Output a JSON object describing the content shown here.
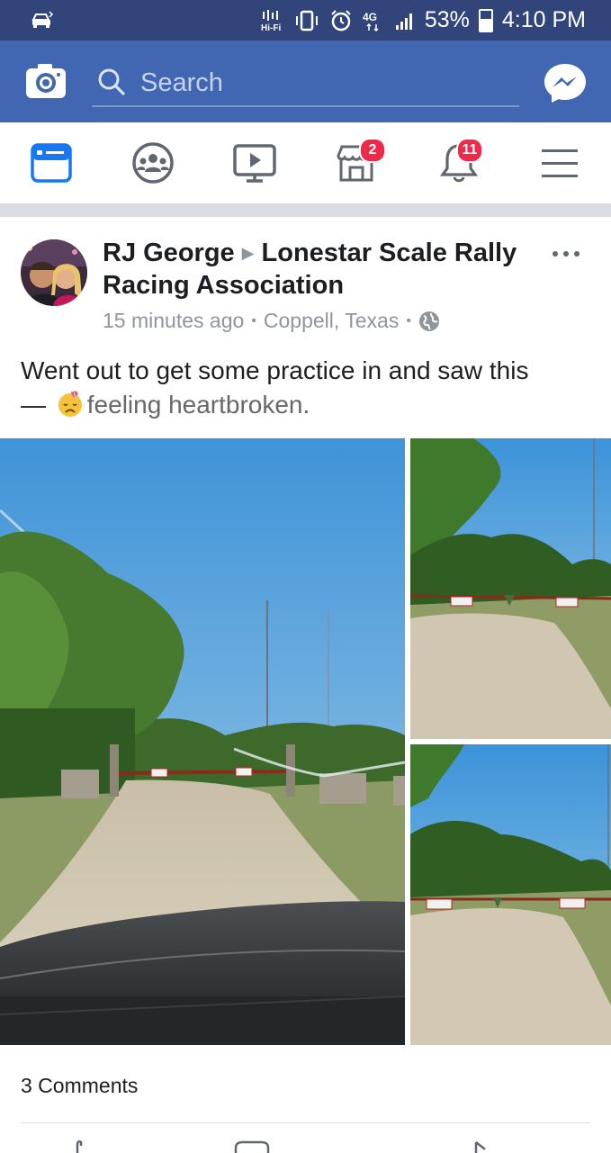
{
  "status_bar": {
    "left_icon": "car-bluetooth-icon",
    "network_type": "4G",
    "battery_percent": "53%",
    "time": "4:10 PM",
    "icons": [
      "hifi-icon",
      "vibrate-icon",
      "alarm-icon",
      "4g-icon",
      "signal-icon",
      "battery-icon"
    ]
  },
  "header": {
    "camera_icon": "camera-icon",
    "search_placeholder": "Search",
    "messenger_icon": "messenger-icon",
    "bar_color": "#4267b2"
  },
  "nav": {
    "tabs": [
      {
        "name": "news-feed",
        "icon": "news-feed-icon",
        "active": true
      },
      {
        "name": "groups",
        "icon": "groups-icon",
        "active": false
      },
      {
        "name": "watch",
        "icon": "watch-icon",
        "active": false
      },
      {
        "name": "marketplace",
        "icon": "marketplace-icon",
        "badge": "2",
        "active": false
      },
      {
        "name": "notifications",
        "icon": "bell-icon",
        "badge": "11",
        "active": false
      },
      {
        "name": "menu",
        "icon": "hamburger-menu-icon",
        "active": false
      }
    ],
    "active_color": "#1877f2",
    "badge_color": "#f02849"
  },
  "post": {
    "author": "RJ George",
    "group": "Lonestar Scale Rally Racing Association",
    "time_ago": "15 minutes ago",
    "location": "Coppell, Texas",
    "privacy_icon": "globe-icon",
    "text": "Went out to get some practice in and saw this",
    "dash": "—",
    "feeling": "feeling heartbroken.",
    "feeling_icon": "heartbroken-emoji-icon",
    "photos": [
      {
        "name": "photo-gate-main"
      },
      {
        "name": "photo-gate-right-top"
      },
      {
        "name": "photo-gate-right-bottom"
      }
    ],
    "comments_count": "3 Comments"
  }
}
